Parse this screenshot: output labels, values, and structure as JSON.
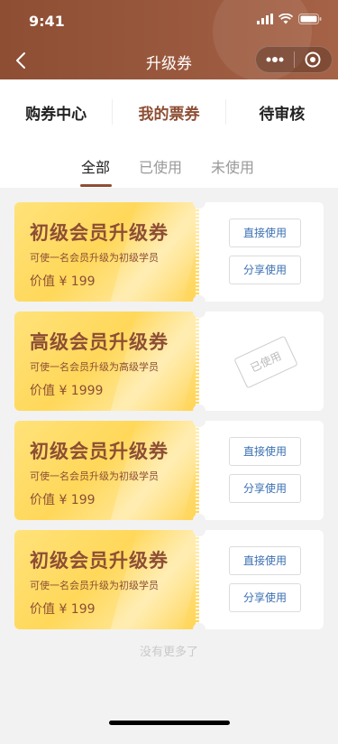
{
  "status_bar": {
    "time": "9:41"
  },
  "nav": {
    "title": "升级券"
  },
  "top_tabs": [
    {
      "label": "购券中心",
      "active": false
    },
    {
      "label": "我的票券",
      "active": true
    },
    {
      "label": "待审核",
      "active": false
    }
  ],
  "sub_tabs": [
    {
      "label": "全部",
      "active": true
    },
    {
      "label": "已使用",
      "active": false
    },
    {
      "label": "未使用",
      "active": false
    }
  ],
  "coupons": [
    {
      "title": "初级会员升级券",
      "desc": "可使一名会员升级为初级学员",
      "price": "价值 ¥ 199",
      "used": false,
      "use_label": "直接使用",
      "share_label": "分享使用"
    },
    {
      "title": "高级会员升级券",
      "desc": "可使一名会员升级为高级学员",
      "price": "价值 ¥ 1999",
      "used": true,
      "used_label": "已使用"
    },
    {
      "title": "初级会员升级券",
      "desc": "可使一名会员升级为初级学员",
      "price": "价值 ¥ 199",
      "used": false,
      "use_label": "直接使用",
      "share_label": "分享使用"
    },
    {
      "title": "初级会员升级券",
      "desc": "可使一名会员升级为初级学员",
      "price": "价值 ¥ 199",
      "used": false,
      "use_label": "直接使用",
      "share_label": "分享使用"
    }
  ],
  "footer": {
    "no_more": "没有更多了"
  },
  "colors": {
    "brand": "#8d4e34",
    "link": "#3a6fb2",
    "coupon": "#ffd85a"
  }
}
